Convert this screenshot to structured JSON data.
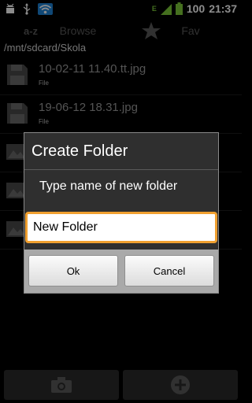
{
  "status_bar": {
    "icons": [
      "android-debug-icon",
      "usb-icon",
      "wifi-icon",
      "signal-icon",
      "battery-icon"
    ],
    "data_type": "E",
    "battery_level": "100",
    "clock": "21:37"
  },
  "tabs": {
    "az": "a-z",
    "browse": "Browse",
    "fav": "Fav"
  },
  "path": "/mnt/sdcard/Skola",
  "files": [
    {
      "name": "10-02-11 11.40.tt.jpg",
      "type": "File"
    },
    {
      "name": "19-06-12 18.31.jpg",
      "type": "File"
    },
    {
      "name": "",
      "type": ""
    },
    {
      "name": "",
      "type": ""
    },
    {
      "name": "",
      "type": ""
    }
  ],
  "dialog": {
    "title": "Create Folder",
    "message": "Type name of new folder",
    "input_value": "New Folder",
    "ok_label": "Ok",
    "cancel_label": "Cancel"
  },
  "bottom_bar": {
    "left_icon": "camera-icon",
    "right_icon": "add-icon"
  },
  "colors": {
    "background": "#000000",
    "dialog_background": "#2f2f2f",
    "input_focus": "#f0a030",
    "button_bar": "#a9a9a9"
  }
}
